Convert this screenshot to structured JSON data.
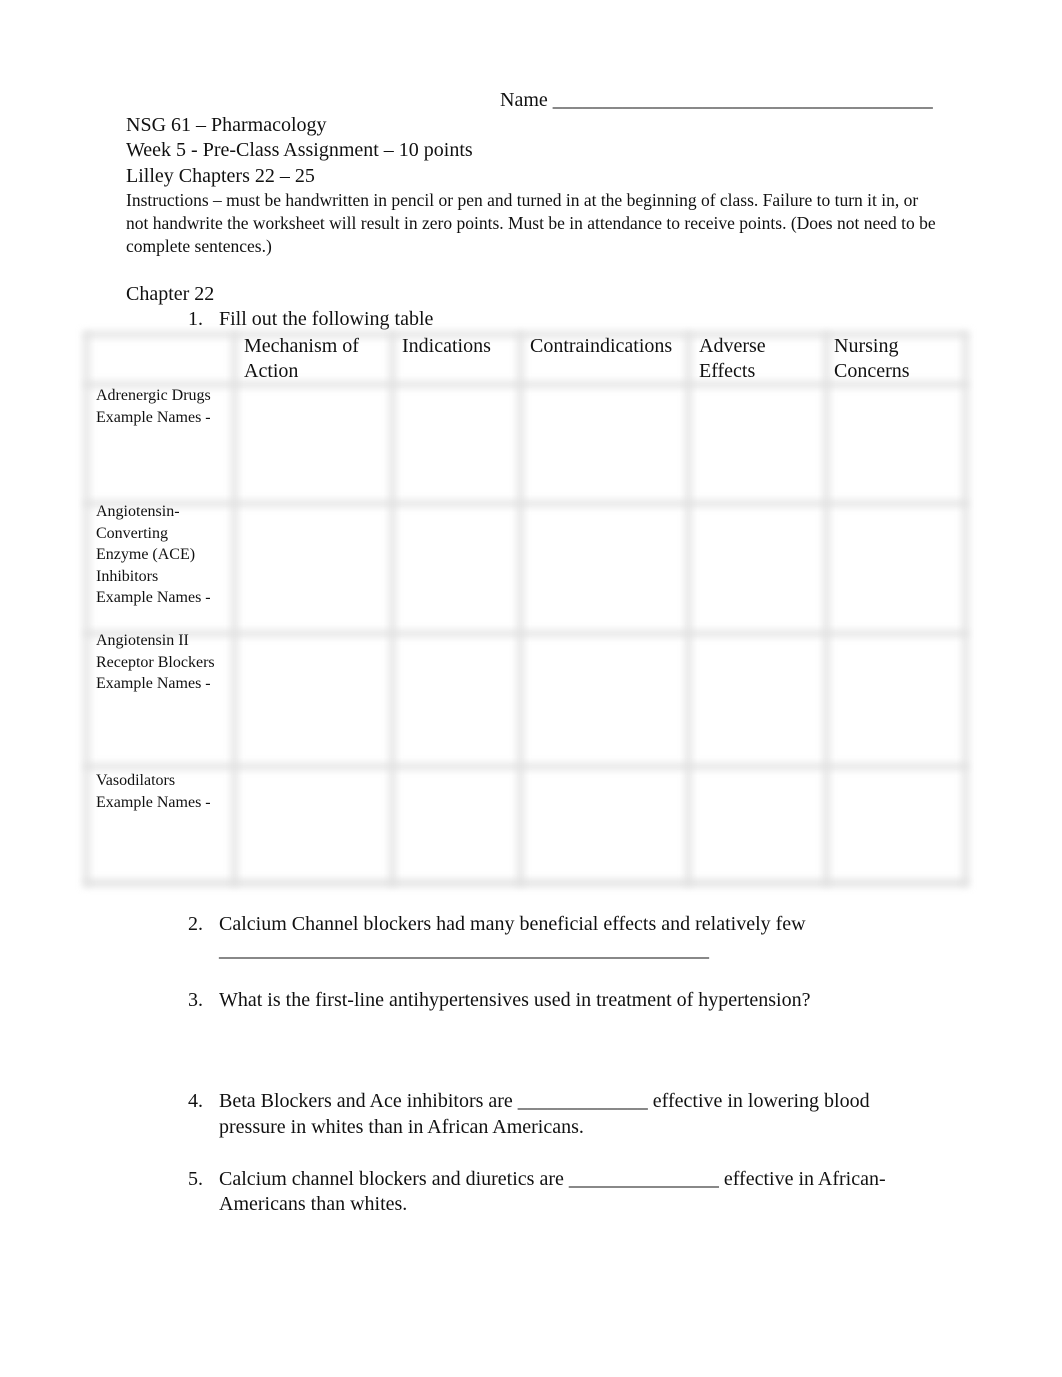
{
  "header": {
    "name_label": "Name ______________________________________",
    "course": "NSG 61 – Pharmacology",
    "assignment": "Week 5 - Pre-Class Assignment – 10 points",
    "chapters": "Lilley Chapters 22 – 25",
    "instructions": "Instructions – must be handwritten in pencil or pen and turned in at the beginning of class.     Failure to turn it in, or not handwrite the worksheet will result in zero points. Must be in attendance to receive points. (Does not need to be complete sentences.)"
  },
  "chapter_heading": "Chapter 22",
  "questions": [
    {
      "number": "1.",
      "text": "Fill out the following table"
    },
    {
      "number": "2.",
      "text": "Calcium Channel blockers had many beneficial effects and relatively few",
      "line2": "_________________________________________________"
    },
    {
      "number": "3.",
      "text": "What is the first-line antihypertensives used in treatment of hypertension?"
    },
    {
      "number": "4.",
      "text": "Beta Blockers and Ace inhibitors are _____________ effective in lowering blood",
      "line2": "pressure in whites than in African Americans."
    },
    {
      "number": "5.",
      "text": "Calcium channel blockers and diuretics are _______________ effective in African-",
      "line2": "Americans than whites."
    }
  ],
  "table": {
    "columns": [
      {
        "line1": "",
        "line2": ""
      },
      {
        "line1": "Mechanism of",
        "line2": "Action"
      },
      {
        "line1": "Indications",
        "line2": ""
      },
      {
        "line1": "Contraindications",
        "line2": ""
      },
      {
        "line1": "Adverse",
        "line2": "Effects"
      },
      {
        "line1": "Nursing",
        "line2": "Concerns"
      }
    ],
    "rows": [
      {
        "lines": [
          "Adrenergic Drugs",
          "Example Names -"
        ]
      },
      {
        "lines": [
          "Angiotensin-",
          "Converting",
          "Enzyme (ACE)",
          "Inhibitors",
          "Example Names -"
        ]
      },
      {
        "lines": [
          "Angiotensin II",
          "Receptor Blockers",
          "Example Names -"
        ]
      },
      {
        "lines": [
          "Vasodilators",
          "Example Names -"
        ]
      }
    ]
  }
}
